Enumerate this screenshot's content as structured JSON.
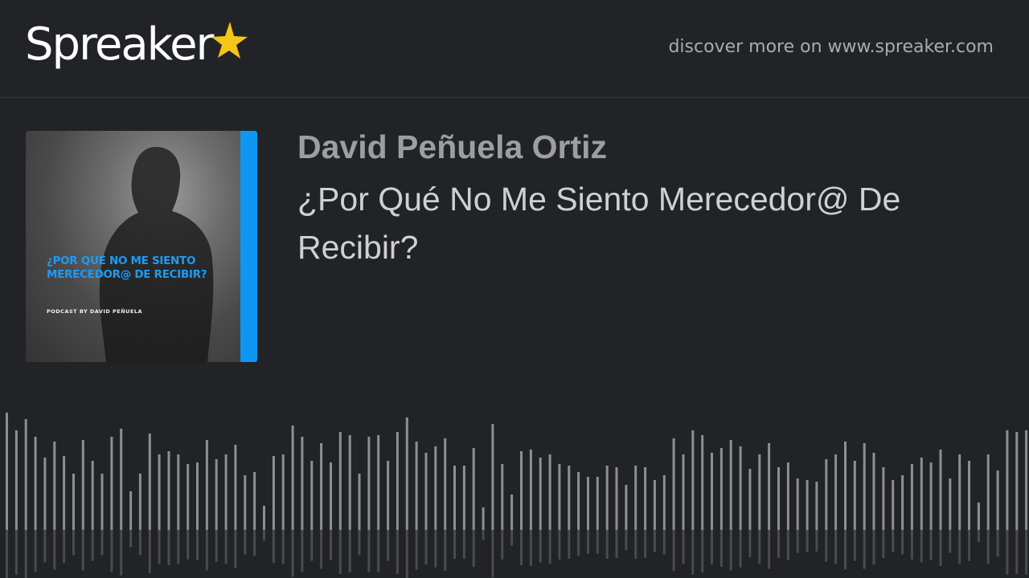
{
  "header": {
    "logo_text": "Spreaker",
    "logo_icon": "star-icon",
    "discover_text": "discover more on www.spreaker.com"
  },
  "podcast": {
    "cover_title": "¿POR QUÉ NO ME SIENTO MERECEDOR@ DE RECIBIR?",
    "cover_subtitle": "PODCAST BY DAVID PEÑUELA",
    "author": "David Peñuela Ortiz",
    "episode_title": "¿Por Qué No Me Siento Merecedor@ De Recibir?"
  },
  "colors": {
    "background": "#222327",
    "accent_blue": "#0d96f2",
    "logo_star": "#f5c518",
    "waveform": "#8e8f93"
  }
}
